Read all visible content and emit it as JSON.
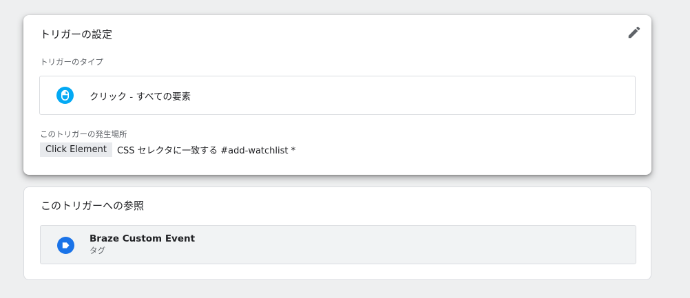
{
  "trigger_config": {
    "title": "トリガーの設定",
    "type_label": "トリガーのタイプ",
    "type_name": "クリック - すべての要素",
    "type_icon": "mouse-icon",
    "fires_on_label": "このトリガーの発生場所",
    "condition": {
      "variable": "Click Element",
      "text": "CSS セレクタに一致する #add-watchlist *"
    },
    "edit_icon": "pencil-icon",
    "colors": {
      "type_icon": "#03a9f4",
      "edit_icon": "#5f6368"
    }
  },
  "references": {
    "title": "このトリガーへの参照",
    "items": [
      {
        "name": "Braze Custom Event",
        "type": "タグ",
        "icon": "tag-icon",
        "icon_color": "#1a73e8"
      }
    ]
  }
}
